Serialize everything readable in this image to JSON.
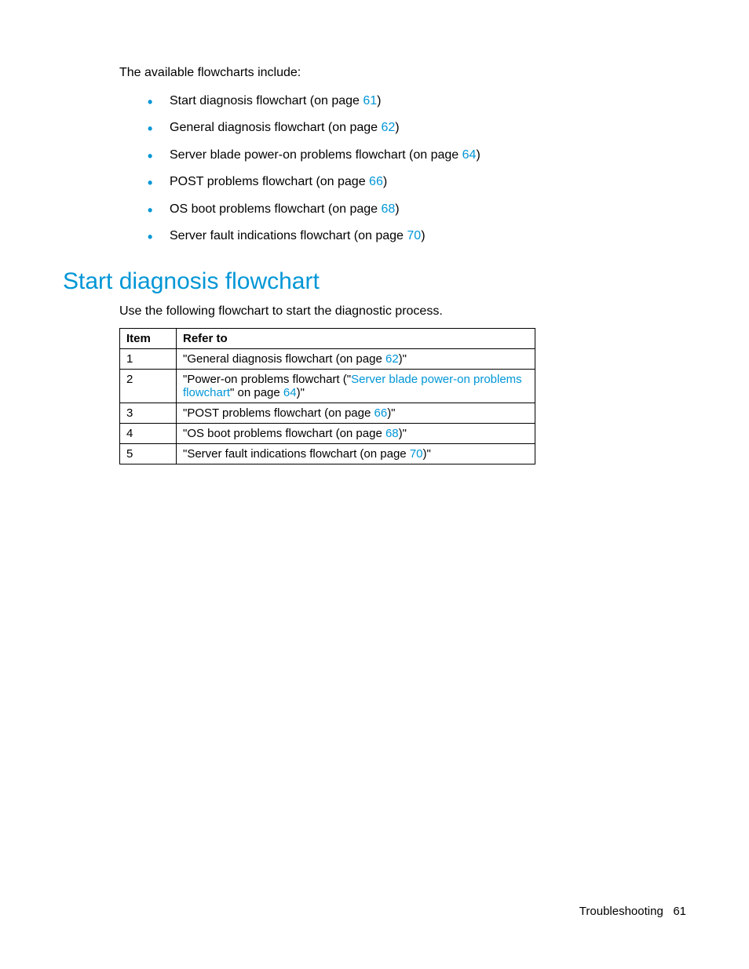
{
  "intro": "The available flowcharts include:",
  "bullets": [
    {
      "prefix": "Start diagnosis flowchart (on page ",
      "link": "61",
      "suffix": ")"
    },
    {
      "prefix": "General diagnosis flowchart (on page ",
      "link": "62",
      "suffix": ")"
    },
    {
      "prefix": "Server blade power-on problems flowchart (on page ",
      "link": "64",
      "suffix": ")"
    },
    {
      "prefix": "POST problems flowchart (on page ",
      "link": "66",
      "suffix": ")"
    },
    {
      "prefix": "OS boot problems flowchart (on page ",
      "link": "68",
      "suffix": ")"
    },
    {
      "prefix": "Server fault indications flowchart (on page ",
      "link": "70",
      "suffix": ")"
    }
  ],
  "heading": "Start diagnosis flowchart",
  "subtext": "Use the following flowchart to start the diagnostic process.",
  "table": {
    "headers": {
      "item": "Item",
      "refer": "Refer to"
    },
    "rows": [
      {
        "item": "1",
        "parts": [
          {
            "text": "\"General diagnosis flowchart (on page "
          },
          {
            "text": "62",
            "link": true
          },
          {
            "text": ")\""
          }
        ]
      },
      {
        "item": "2",
        "parts": [
          {
            "text": "\"Power-on problems flowchart (\""
          },
          {
            "text": "Server blade power-on problems flowchart",
            "link": true
          },
          {
            "text": "\" on page "
          },
          {
            "text": "64",
            "link": true
          },
          {
            "text": ")\""
          }
        ]
      },
      {
        "item": "3",
        "parts": [
          {
            "text": "\"POST problems flowchart (on page "
          },
          {
            "text": "66",
            "link": true
          },
          {
            "text": ")\""
          }
        ]
      },
      {
        "item": "4",
        "parts": [
          {
            "text": "\"OS boot problems flowchart (on page "
          },
          {
            "text": "68",
            "link": true
          },
          {
            "text": ")\""
          }
        ]
      },
      {
        "item": "5",
        "parts": [
          {
            "text": "\"Server fault indications flowchart (on page "
          },
          {
            "text": "70",
            "link": true
          },
          {
            "text": ")\""
          }
        ]
      }
    ]
  },
  "footer": {
    "section": "Troubleshooting",
    "page": "61"
  }
}
